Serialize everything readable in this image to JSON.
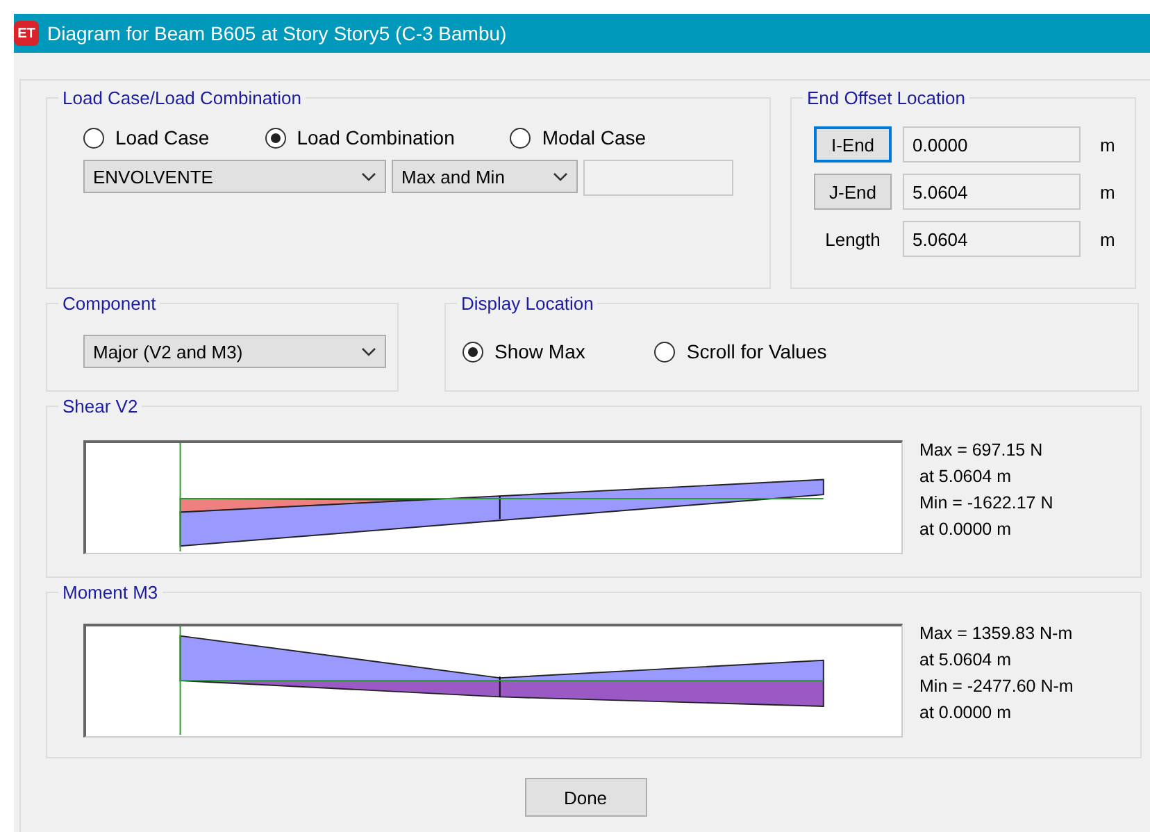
{
  "window": {
    "icon_text": "ET",
    "title": "Diagram for Beam B605 at Story Story5 (C-3 Bambu)"
  },
  "load_group": {
    "title": "Load Case/Load Combination",
    "options": [
      {
        "label": "Load Case",
        "selected": false
      },
      {
        "label": "Load Combination",
        "selected": true
      },
      {
        "label": "Modal Case",
        "selected": false
      }
    ],
    "combo": "ENVOLVENTE",
    "mode": "Max and Min"
  },
  "end_offset": {
    "title": "End Offset Location",
    "rows": [
      {
        "kind": "button",
        "label": "I-End",
        "value": "0.0000",
        "unit": "m",
        "focused": true
      },
      {
        "kind": "button",
        "label": "J-End",
        "value": "5.0604",
        "unit": "m",
        "focused": false
      },
      {
        "kind": "label",
        "label": "Length",
        "value": "5.0604",
        "unit": "m"
      }
    ]
  },
  "component": {
    "title": "Component",
    "value": "Major (V2 and M3)"
  },
  "display_location": {
    "title": "Display Location",
    "options": [
      {
        "label": "Show Max",
        "selected": true
      },
      {
        "label": "Scroll for Values",
        "selected": false
      }
    ]
  },
  "diagrams": [
    {
      "kind": "shear",
      "title": "Shear V2",
      "readings": [
        "Max = 697.15 N",
        "at 5.0604 m",
        "Min = -1622.17 N",
        "at 0.0000 m"
      ]
    },
    {
      "kind": "moment",
      "title": "Moment M3",
      "readings": [
        "Max = 1359.83 N-m",
        "at 5.0604 m",
        "Min = -2477.60 N-m",
        "at 0.0000 m"
      ]
    }
  ],
  "done_button": "Done"
}
